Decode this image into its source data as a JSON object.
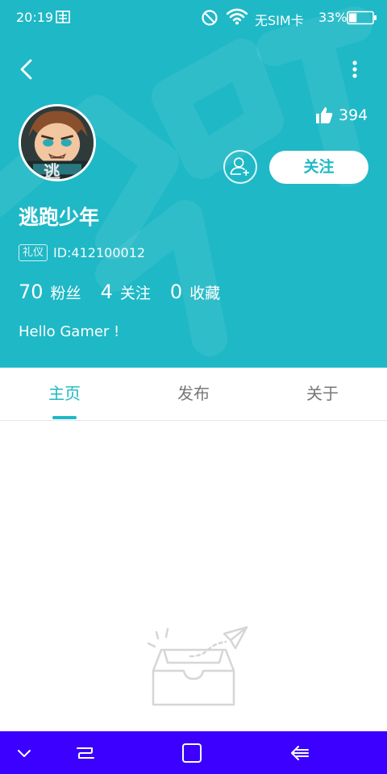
{
  "status_bar": {
    "time": "20:19",
    "carrier": "无SIM卡",
    "battery": "33%",
    "battery_level": 0.33
  },
  "profile": {
    "likes": "394",
    "follow_label": "关注",
    "username": "逃跑少年",
    "badge": "礼仪",
    "id": "ID:412100012",
    "stats": [
      {
        "num": "70",
        "label": "粉丝"
      },
      {
        "num": "4",
        "label": "关注"
      },
      {
        "num": "0",
        "label": "收藏"
      }
    ],
    "bio": "Hello Gamer !",
    "avatar_text": "逃"
  },
  "tabs": [
    {
      "label": "主页",
      "active": true
    },
    {
      "label": "发布",
      "active": false
    },
    {
      "label": "关于",
      "active": false
    }
  ],
  "colors": {
    "accent": "#1fb8c6",
    "navbar": "#3b00ff"
  },
  "icons": [
    "back-arrow-icon",
    "more-icon",
    "thumb-up-icon",
    "add-friend-icon",
    "empty-inbox-icon",
    "chevron-down-icon",
    "recents-icon",
    "home-icon",
    "back-icon"
  ]
}
